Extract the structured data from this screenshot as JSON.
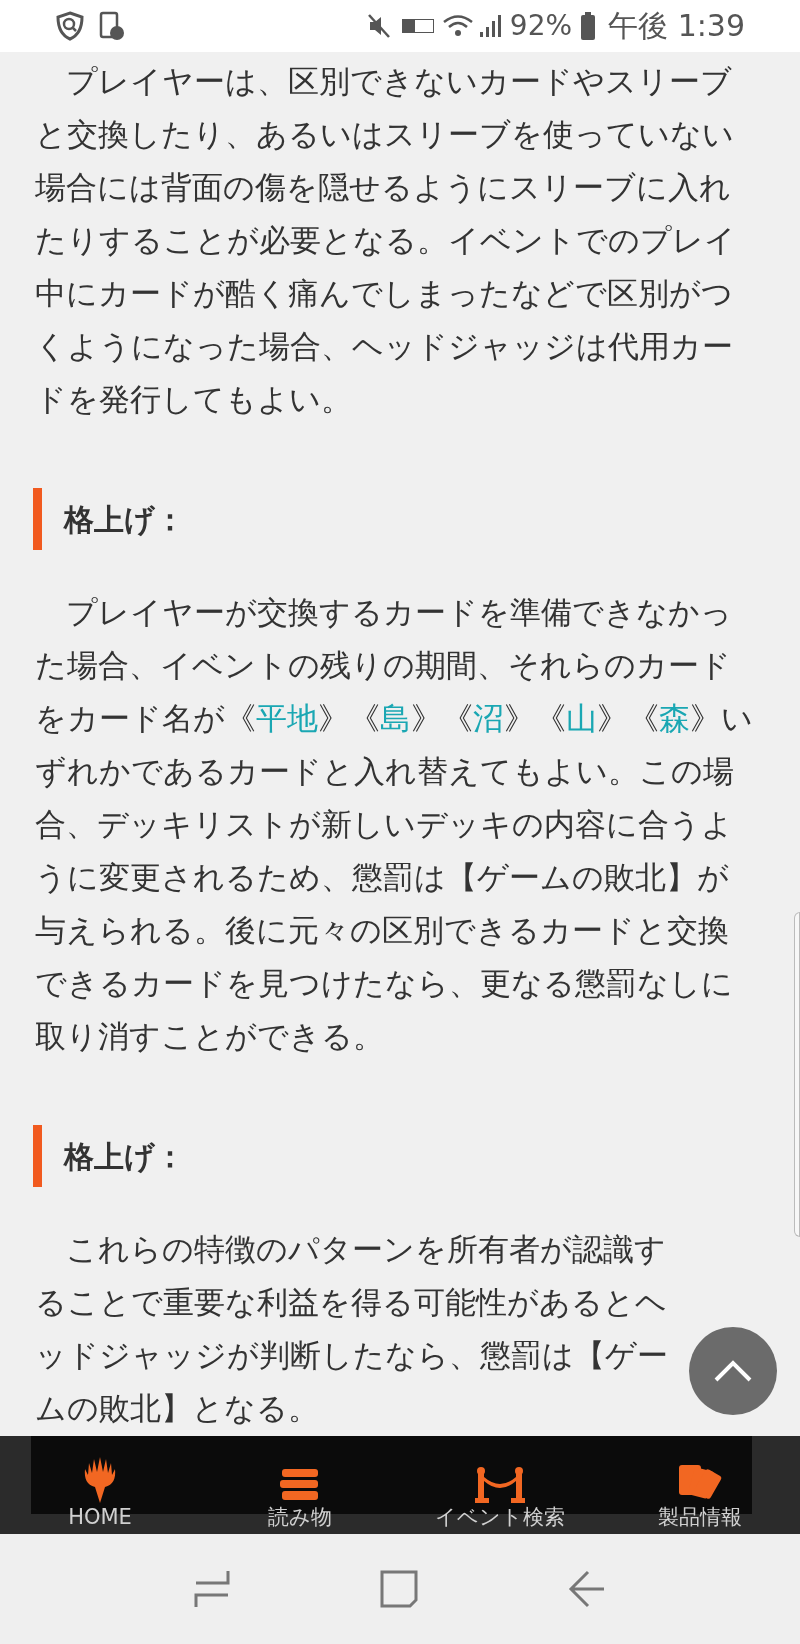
{
  "status_bar": {
    "battery": "92%",
    "time": "午後 1:39"
  },
  "content": [
    {
      "kind": "paragraph",
      "parts": [
        {
          "kind": "text",
          "text": "プレイヤーは、区別できないカードやスリーブと交換したり、あるいはスリーブを使っていない場合には背面の傷を隠せるようにスリーブに入れたりすることが必要となる。イベントでのプレイ中にカードが酷く痛んでしまったなどで区別がつくようになった場合、ヘッドジャッジは代用カードを発行してもよい。"
        }
      ]
    },
    {
      "kind": "heading",
      "text": "格上げ："
    },
    {
      "kind": "paragraph",
      "parts": [
        {
          "kind": "text",
          "text": "プレイヤーが交換するカードを準備できなかった場合、イベントの残りの期間、それらのカードをカード名が《"
        },
        {
          "kind": "link",
          "text": "平地"
        },
        {
          "kind": "text",
          "text": "》《"
        },
        {
          "kind": "link",
          "text": "島"
        },
        {
          "kind": "text",
          "text": "》《"
        },
        {
          "kind": "link",
          "text": "沼"
        },
        {
          "kind": "text",
          "text": "》《"
        },
        {
          "kind": "link",
          "text": "山"
        },
        {
          "kind": "text",
          "text": "》《"
        },
        {
          "kind": "link",
          "text": "森"
        },
        {
          "kind": "text",
          "text": "》いずれかであるカードと入れ替えてもよい。この場合、デッキリストが新しいデッキの内容に合うように変更されるため、懲罰は【ゲームの敗北】が与えられる。後に元々の区別できるカードと交換できるカードを見つけたなら、更なる懲罰なしに取り消すことができる。"
        }
      ]
    },
    {
      "kind": "heading",
      "text": "格上げ："
    },
    {
      "kind": "paragraph",
      "parts": [
        {
          "kind": "text",
          "text": "これらの特徴のパターンを所有者が認識することで重要な利益を得る可能性があるとヘッドジャッジが判断したなら、懲罰は【ゲームの敗北】となる。"
        }
      ]
    }
  ],
  "bottom_nav": [
    {
      "kind": "home",
      "label": "HOME"
    },
    {
      "kind": "reading",
      "label": "読み物"
    },
    {
      "kind": "events",
      "label": "イベント検索"
    },
    {
      "kind": "products",
      "label": "製品情報"
    }
  ]
}
